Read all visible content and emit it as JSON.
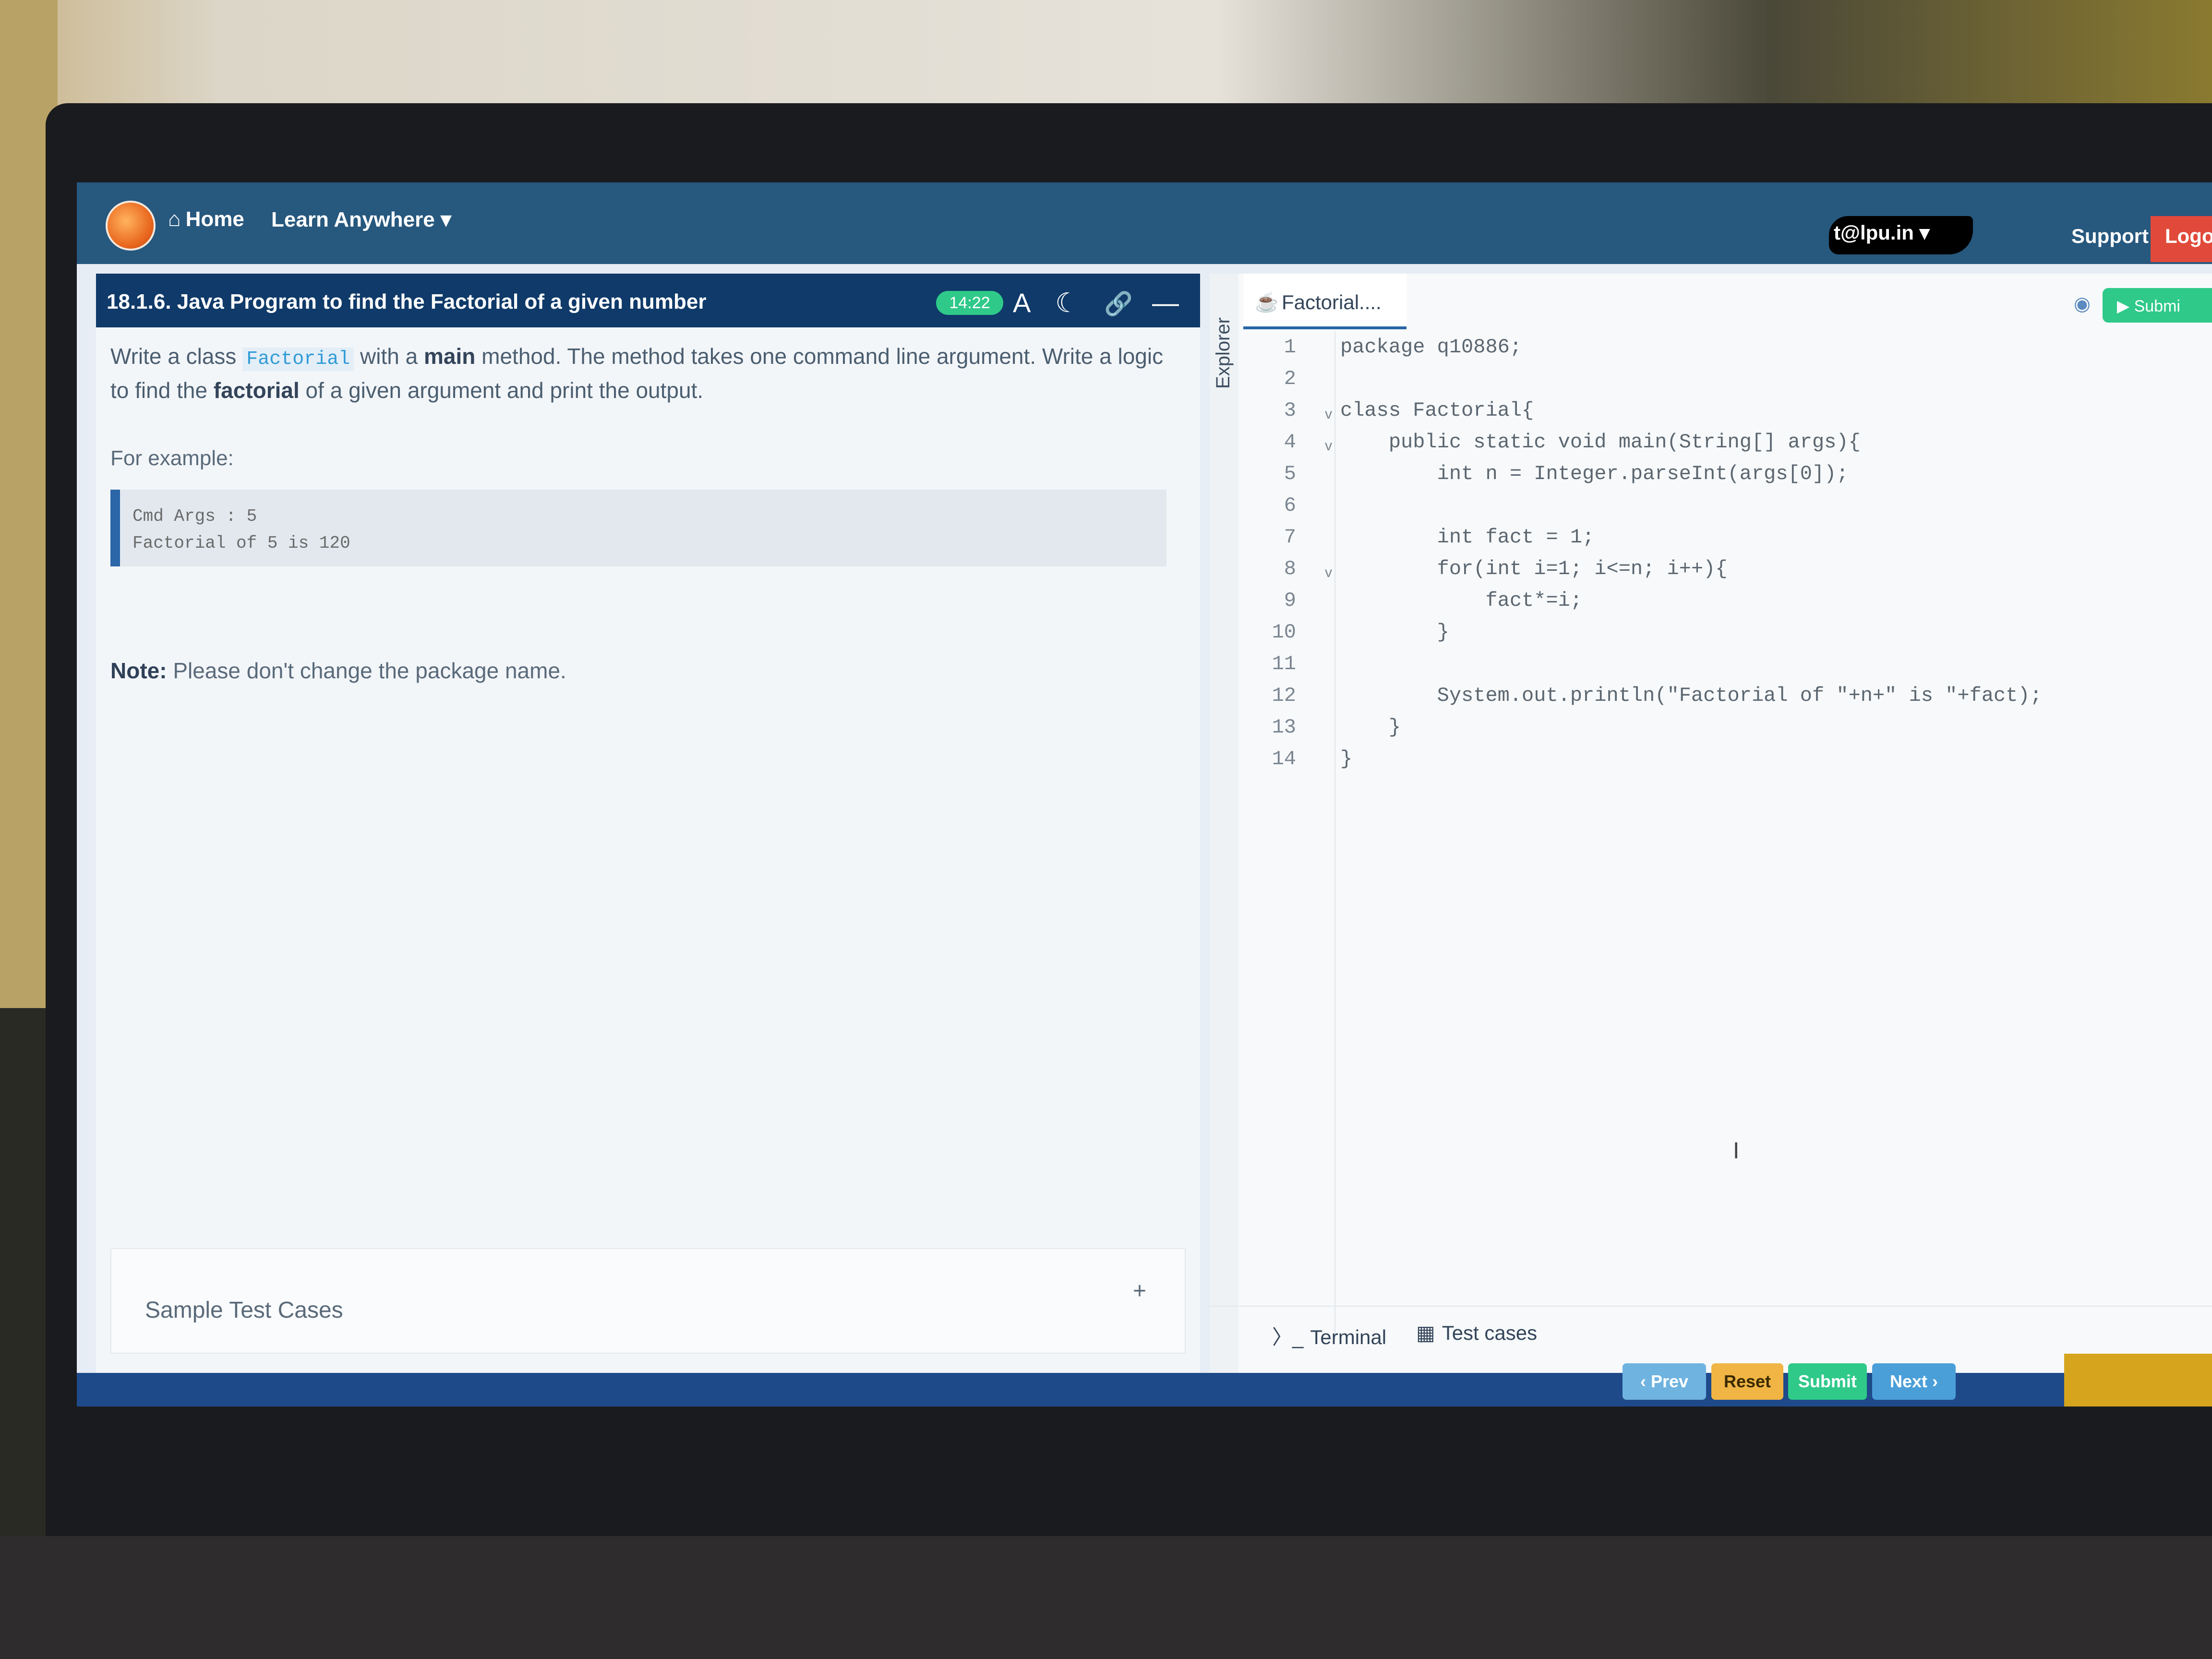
{
  "navbar": {
    "home": "Home",
    "learn": "Learn Anywhere",
    "user": "t@lpu.in",
    "support": "Support",
    "logout": "Logo"
  },
  "question": {
    "title": "18.1.6. Java Program to find the Factorial of a given number",
    "timer": "14:22",
    "text_part1": "Write a class ",
    "class_name": "Factorial",
    "text_part2": " with a ",
    "main_word": "main",
    "text_part3": " method. The method takes one command line argument. Write a logic to find the ",
    "factorial_word": "factorial",
    "text_part4": " of a given argument and print the output.",
    "for_example": "For example:",
    "example_line1": "Cmd Args : 5",
    "example_line2": "Factorial of 5 is 120",
    "note_label": "Note:",
    "note_text": " Please don't change the package name.",
    "sample_test_cases": "Sample Test Cases",
    "sample_plus": "+"
  },
  "editor": {
    "explorer": "Explorer",
    "tab_label": "Factorial....",
    "submit_top": "Submi",
    "lines": [
      {
        "num": "1",
        "text": "package q10886;"
      },
      {
        "num": "2",
        "text": ""
      },
      {
        "num": "3",
        "text": "class Factorial{"
      },
      {
        "num": "4",
        "text": "    public static void main(String[] args){"
      },
      {
        "num": "5",
        "text": "        int n = Integer.parseInt(args[0]);"
      },
      {
        "num": "6",
        "text": ""
      },
      {
        "num": "7",
        "text": "        int fact = 1;"
      },
      {
        "num": "8",
        "text": "        for(int i=1; i<=n; i++){"
      },
      {
        "num": "9",
        "text": "            fact*=i;"
      },
      {
        "num": "10",
        "text": "        }"
      },
      {
        "num": "11",
        "text": ""
      },
      {
        "num": "12",
        "text": "        System.out.println(\"Factorial of \"+n+\" is \"+fact);"
      },
      {
        "num": "13",
        "text": "    }"
      },
      {
        "num": "14",
        "text": "}"
      }
    ],
    "terminal": "Terminal",
    "test_cases": "Test cases"
  },
  "footer": {
    "prev": "‹ Prev",
    "reset": "Reset",
    "submit": "Submit",
    "next": "Next ›"
  },
  "colors": {
    "navbar": "#27587e",
    "question_header": "#0f3a69",
    "timer": "#2fc98a",
    "logout": "#e14a3b",
    "prev_button": "#6fb3e0",
    "reset_button": "#f0b545",
    "submit_button": "#2fc98a",
    "next_button": "#4a9fd8"
  }
}
